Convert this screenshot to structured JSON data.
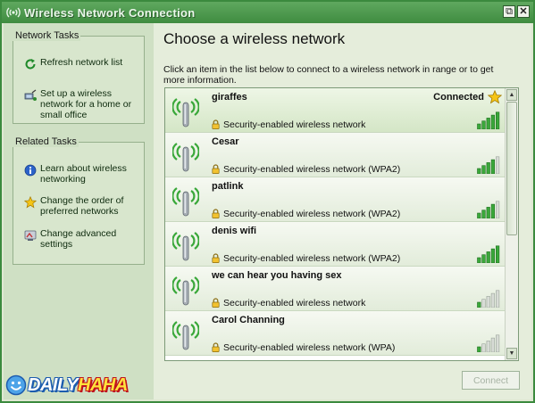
{
  "window": {
    "title": "Wireless Network Connection",
    "restore_label": "⧉",
    "close_label": "✕"
  },
  "network_tasks": {
    "title": "Network Tasks",
    "items": [
      {
        "label": "Refresh network list",
        "icon": "refresh-icon"
      },
      {
        "label": "Set up a wireless network for a home or small office",
        "icon": "setup-network-icon"
      }
    ]
  },
  "related_tasks": {
    "title": "Related Tasks",
    "items": [
      {
        "label": "Learn about wireless networking",
        "icon": "info-icon"
      },
      {
        "label": "Change the order of preferred networks",
        "icon": "star-icon"
      },
      {
        "label": "Change advanced settings",
        "icon": "settings-icon"
      }
    ]
  },
  "main": {
    "heading": "Choose a wireless network",
    "instructions": "Click an item in the list below to connect to a wireless network in range or to get more information."
  },
  "networks": [
    {
      "name": "giraffes",
      "security": "Security-enabled wireless network",
      "status": "Connected",
      "signal_bars": 5,
      "preferred": true
    },
    {
      "name": "Cesar",
      "security": "Security-enabled wireless network (WPA2)",
      "status": "",
      "signal_bars": 4,
      "preferred": false
    },
    {
      "name": "patlink",
      "security": "Security-enabled wireless network (WPA2)",
      "status": "",
      "signal_bars": 4,
      "preferred": false
    },
    {
      "name": "denis wifi",
      "security": "Security-enabled wireless network (WPA2)",
      "status": "",
      "signal_bars": 5,
      "preferred": false
    },
    {
      "name": "we can hear you having sex",
      "security": "Security-enabled wireless network",
      "status": "",
      "signal_bars": 1,
      "preferred": false
    },
    {
      "name": "Carol Channing",
      "security": "Security-enabled wireless network (WPA)",
      "status": "",
      "signal_bars": 1,
      "preferred": false
    }
  ],
  "connect_button": {
    "label": "Connect",
    "enabled": false
  },
  "watermark": {
    "part1": "DAILY",
    "part2": "HAHA"
  },
  "colors": {
    "title_bar": "#4b984c",
    "signal_on": "#3aa83a",
    "signal_off": "#d8dcd6",
    "star": "#f5c516"
  }
}
